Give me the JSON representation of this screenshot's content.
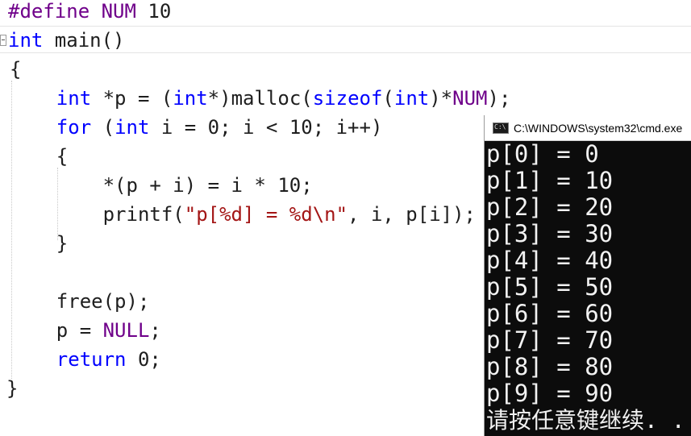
{
  "editor": {
    "lines": [
      {
        "segments": [
          {
            "t": "#define NUM ",
            "c": "pp"
          },
          {
            "t": "10",
            "c": ""
          }
        ]
      },
      {
        "segments": [
          {
            "t": "int",
            "c": "kw"
          },
          {
            "t": " main()",
            "c": ""
          }
        ]
      },
      {
        "segments": [
          {
            "t": "{",
            "c": ""
          }
        ]
      },
      {
        "segments": [
          {
            "t": "    ",
            "c": ""
          },
          {
            "t": "int",
            "c": "kw"
          },
          {
            "t": " *p = (",
            "c": ""
          },
          {
            "t": "int",
            "c": "kw"
          },
          {
            "t": "*)malloc(",
            "c": ""
          },
          {
            "t": "sizeof",
            "c": "kw"
          },
          {
            "t": "(",
            "c": ""
          },
          {
            "t": "int",
            "c": "kw"
          },
          {
            "t": ")*",
            "c": ""
          },
          {
            "t": "NUM",
            "c": "pp"
          },
          {
            "t": ");",
            "c": ""
          }
        ]
      },
      {
        "segments": [
          {
            "t": "    ",
            "c": ""
          },
          {
            "t": "for",
            "c": "kw"
          },
          {
            "t": " (",
            "c": ""
          },
          {
            "t": "int",
            "c": "kw"
          },
          {
            "t": " i = 0; i < 10; i++)",
            "c": ""
          }
        ]
      },
      {
        "segments": [
          {
            "t": "    {",
            "c": ""
          }
        ]
      },
      {
        "segments": [
          {
            "t": "        *(p + i) = i * 10;",
            "c": ""
          }
        ]
      },
      {
        "segments": [
          {
            "t": "        printf(",
            "c": ""
          },
          {
            "t": "\"p[%d] = %d\\n\"",
            "c": "str"
          },
          {
            "t": ", i, p[i]);",
            "c": ""
          }
        ]
      },
      {
        "segments": [
          {
            "t": "    }",
            "c": ""
          }
        ]
      },
      {
        "segments": [
          {
            "t": "",
            "c": ""
          }
        ]
      },
      {
        "segments": [
          {
            "t": "    free(p);",
            "c": ""
          }
        ]
      },
      {
        "segments": [
          {
            "t": "    p = ",
            "c": ""
          },
          {
            "t": "NULL",
            "c": "pp"
          },
          {
            "t": ";",
            "c": ""
          }
        ]
      },
      {
        "segments": [
          {
            "t": "    ",
            "c": ""
          },
          {
            "t": "return",
            "c": "kw"
          },
          {
            "t": " 0;",
            "c": ""
          }
        ]
      },
      {
        "segments": [
          {
            "t": "}",
            "c": ""
          }
        ]
      }
    ]
  },
  "console": {
    "title": "C:\\WINDOWS\\system32\\cmd.exe",
    "icon": "cmd-window-icon",
    "output": [
      "p[0] = 0",
      "p[1] = 10",
      "p[2] = 20",
      "p[3] = 30",
      "p[4] = 40",
      "p[5] = 50",
      "p[6] = 60",
      "p[7] = 70",
      "p[8] = 80",
      "p[9] = 90"
    ],
    "prompt": "请按任意键继续. . ."
  },
  "colors": {
    "keyword": "#0000ff",
    "preprocessor": "#6f008a",
    "string": "#a31515",
    "console_bg": "#0c0c0c",
    "console_fg": "#f2f2f2"
  }
}
